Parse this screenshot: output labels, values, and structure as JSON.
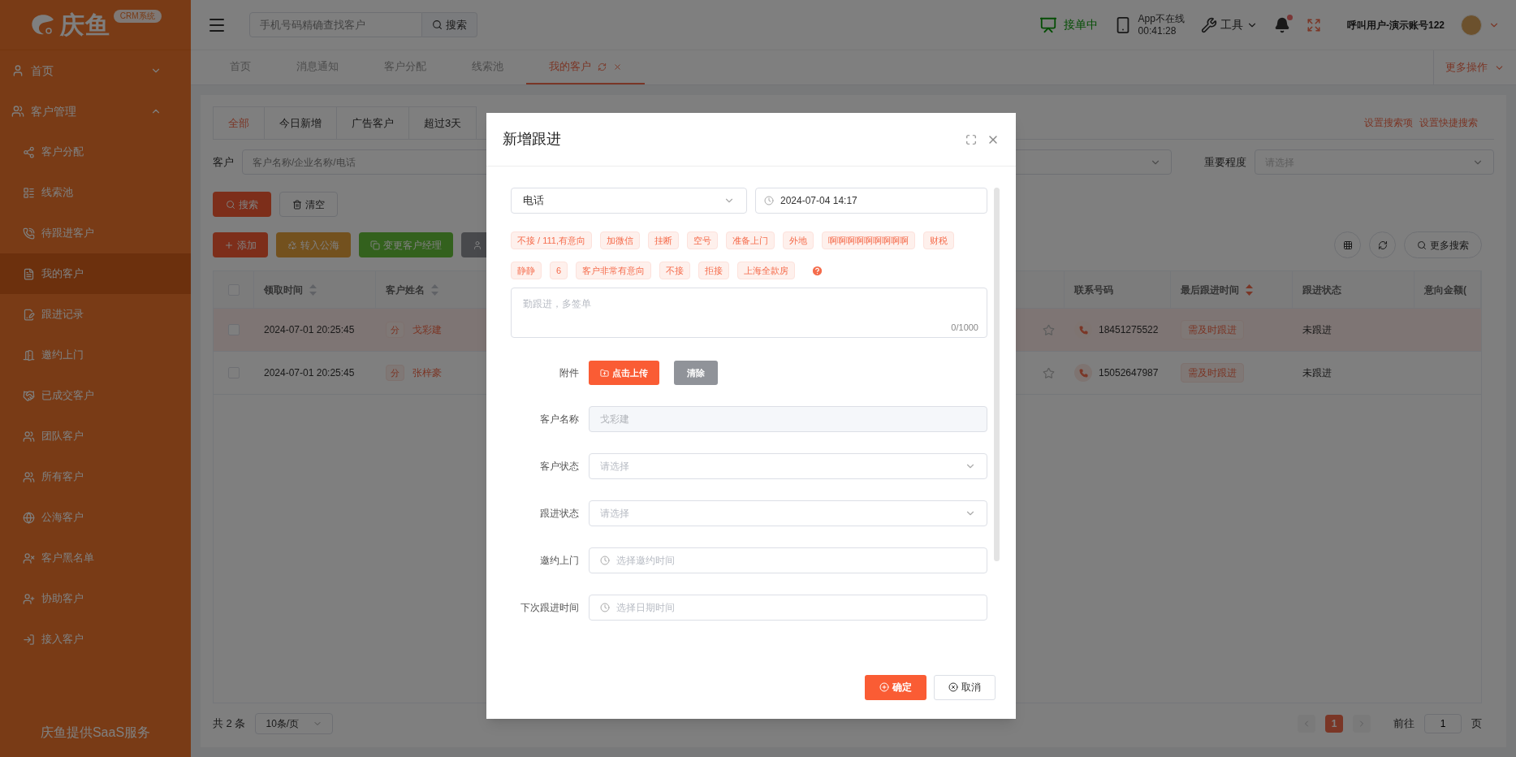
{
  "topbar": {
    "search": {
      "placeholder": "手机号码精确查找客户",
      "button": "搜索"
    },
    "status": "接单中",
    "app_status": {
      "line1": "App不在线",
      "line2": "00:41:28"
    },
    "tools": "工具",
    "notification_dot": true,
    "user": "呼叫用户-演示账号122"
  },
  "sidebar": {
    "logo": {
      "name": "庆鱼",
      "badge": "CRM系统"
    },
    "items": [
      {
        "label": "首页",
        "expanded": false
      },
      {
        "label": "客户管理",
        "expanded": true,
        "children": [
          {
            "label": "客户分配",
            "selected": false
          },
          {
            "label": "线索池",
            "selected": false
          },
          {
            "label": "待跟进客户",
            "selected": false
          },
          {
            "label": "我的客户",
            "selected": true
          },
          {
            "label": "跟进记录",
            "selected": false
          },
          {
            "label": "邀约上门",
            "selected": false
          },
          {
            "label": "已成交客户",
            "selected": false
          },
          {
            "label": "团队客户",
            "selected": false
          },
          {
            "label": "所有客户",
            "selected": false
          },
          {
            "label": "公海客户",
            "selected": false
          },
          {
            "label": "客户黑名单",
            "selected": false
          },
          {
            "label": "协助客户",
            "selected": false
          },
          {
            "label": "接入客户",
            "selected": false
          }
        ]
      }
    ],
    "footer": "庆鱼提供SaaS服务"
  },
  "page_tabs": {
    "items": [
      {
        "label": "首页",
        "selected": false
      },
      {
        "label": "消息通知",
        "selected": false
      },
      {
        "label": "客户分配",
        "selected": false
      },
      {
        "label": "线索池",
        "selected": false
      },
      {
        "label": "我的客户",
        "selected": true
      }
    ],
    "more": "更多操作"
  },
  "content": {
    "filter_tabs": [
      {
        "label": "全部",
        "selected": true
      },
      {
        "label": "今日新增",
        "selected": false
      },
      {
        "label": "广告客户",
        "selected": false
      },
      {
        "label": "超过3天",
        "selected": false
      }
    ],
    "links": [
      "设置搜索项",
      "设置快捷搜索"
    ],
    "filters": {
      "customer": {
        "label": "客户",
        "placeholder": "客户名称/企业名称/电话"
      },
      "importance": {
        "label": "重要程度",
        "placeholder": "请选择"
      }
    },
    "search_button": "搜索",
    "clear_button": "清空",
    "actions": [
      {
        "label": "添加",
        "kind": "danger"
      },
      {
        "label": "转入公海",
        "kind": "warning"
      },
      {
        "label": "变更客户经理",
        "kind": "success"
      },
      {
        "kind": "info"
      }
    ],
    "more_search": "更多搜索",
    "table": {
      "header_checked": false,
      "columns": [
        {
          "label": "领取时间",
          "sortable": true,
          "sort_active": false
        },
        {
          "label": "客户姓名",
          "sortable": true,
          "sort_active": false
        },
        {
          "label": "联系号码",
          "sortable": false
        },
        {
          "label": "最后跟进时间",
          "sortable": true,
          "sort_active": true
        },
        {
          "label": "跟进状态",
          "sortable": false
        },
        {
          "label": "意向金额(",
          "sortable": false
        }
      ],
      "rows": [
        {
          "highlighted": true,
          "checked": false,
          "time": "2024-07-01 20:25:45",
          "tag": "分",
          "name": "戈彩建",
          "phone": "18451275522",
          "follow_tag": "需及时跟进",
          "status": "未跟进"
        },
        {
          "highlighted": false,
          "checked": false,
          "time": "2024-07-01 20:25:45",
          "tag": "分",
          "name": "张梓豪",
          "phone": "15052647987",
          "follow_tag": "需及时跟进",
          "status": "未跟进"
        }
      ]
    },
    "pagination": {
      "total": "共 2 条",
      "page_size": "10条/页",
      "pages": [
        {
          "label": "1",
          "selected": true
        }
      ],
      "goto_label": "前往",
      "goto_value": "1",
      "page_suffix": "页"
    }
  },
  "modal": {
    "title": "新增跟进",
    "method": "电话",
    "datetime": "2024-07-04 14:17",
    "phrases": [
      "不接 / 111,有意向",
      "加微信",
      "挂断",
      "空号",
      "准备上门",
      "外地",
      "啊啊啊啊啊啊啊啊啊",
      "财税",
      "静静",
      "6",
      "客户非常有意向",
      "不接",
      "拒接",
      "上海全款房"
    ],
    "note": {
      "placeholder": "勤跟进，多签单",
      "counter": "0/1000"
    },
    "attachment": {
      "label": "附件",
      "upload": "点击上传",
      "clear": "清除"
    },
    "fields": [
      {
        "kind": "text",
        "label": "客户名称",
        "value": "戈彩建",
        "disabled": true
      },
      {
        "kind": "select",
        "label": "客户状态",
        "placeholder": "请选择"
      },
      {
        "kind": "select",
        "label": "跟进状态",
        "placeholder": "请选择"
      },
      {
        "kind": "date",
        "label": "邀约上门",
        "placeholder": "选择邀约时间"
      },
      {
        "kind": "date",
        "label": "下次跟进时间",
        "placeholder": "选择日期时间"
      }
    ],
    "confirm": "确定",
    "cancel": "取消"
  }
}
